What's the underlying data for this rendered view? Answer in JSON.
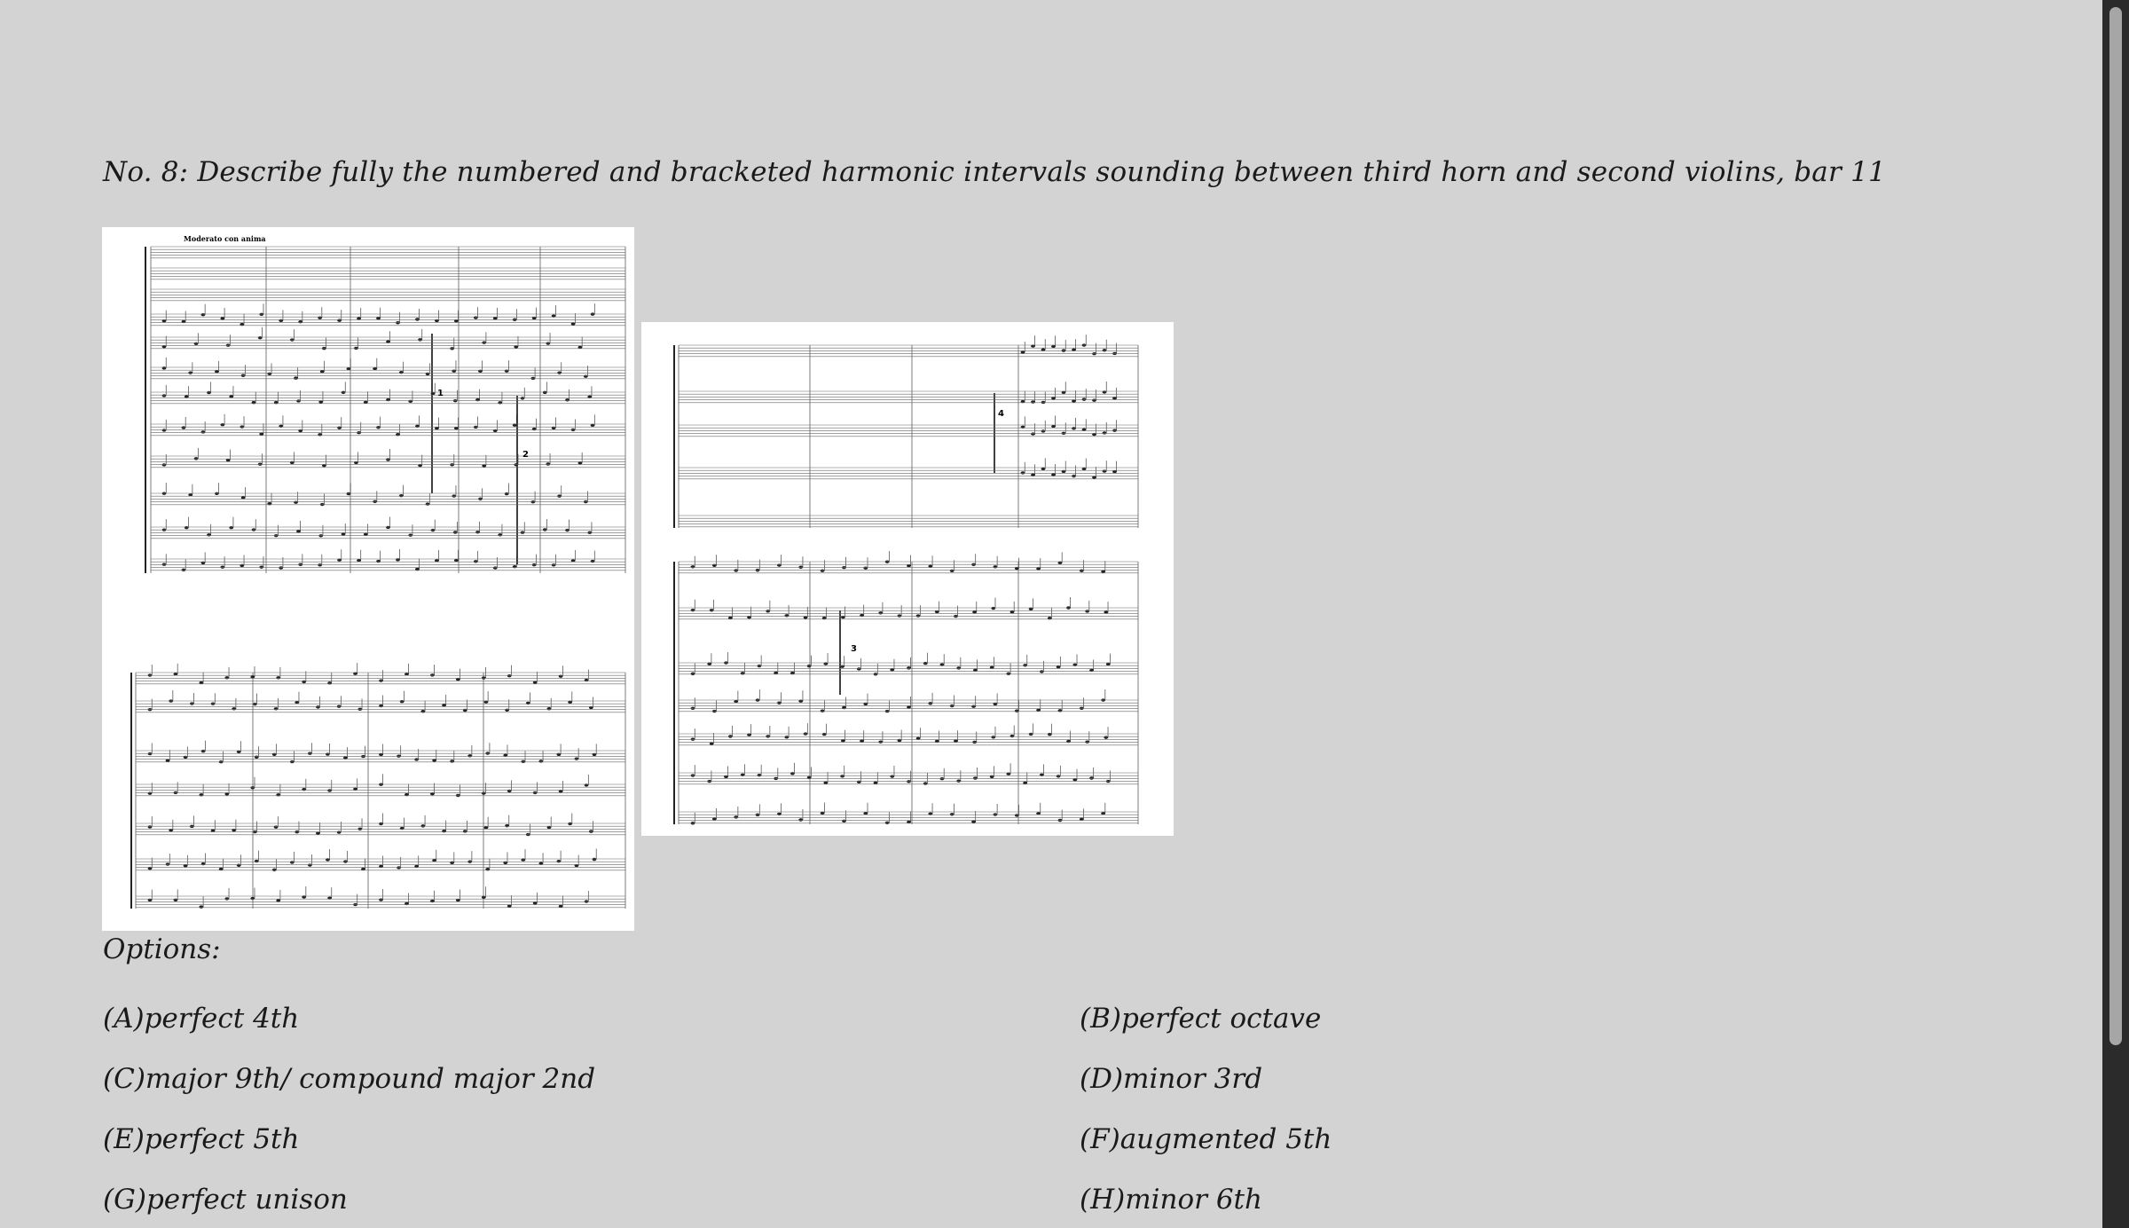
{
  "question": {
    "text": "No. 8: Describe fully the numbered and bracketed harmonic intervals sounding between third horn and second violins, bar 11"
  },
  "options_label": "Options:",
  "options": [
    {
      "label": "(A)perfect 4th"
    },
    {
      "label": "(B)perfect octave"
    },
    {
      "label": "(C)major 9th/ compound major 2nd"
    },
    {
      "label": "(D)minor 3rd"
    },
    {
      "label": "(E)perfect 5th"
    },
    {
      "label": "(F)augmented 5th"
    },
    {
      "label": "(G)perfect unison"
    },
    {
      "label": "(H)minor 6th"
    }
  ],
  "score": {
    "tempo_marking": "Moderato con anima",
    "bracket_numbers": [
      "1",
      "2",
      "3",
      "4"
    ]
  }
}
